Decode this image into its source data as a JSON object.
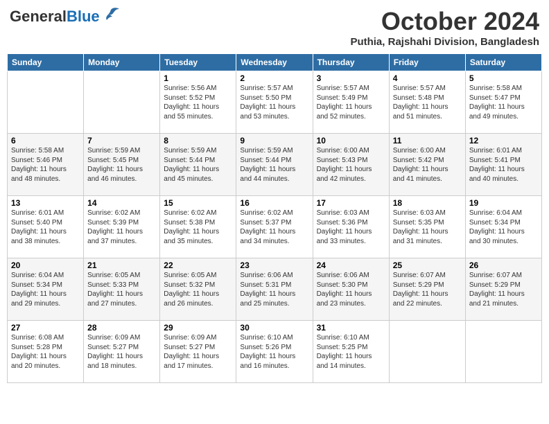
{
  "header": {
    "logo_general": "General",
    "logo_blue": "Blue",
    "month_title": "October 2024",
    "subtitle": "Puthia, Rajshahi Division, Bangladesh"
  },
  "days_of_week": [
    "Sunday",
    "Monday",
    "Tuesday",
    "Wednesday",
    "Thursday",
    "Friday",
    "Saturday"
  ],
  "weeks": [
    [
      {
        "day": "",
        "info": ""
      },
      {
        "day": "",
        "info": ""
      },
      {
        "day": "1",
        "info": "Sunrise: 5:56 AM\nSunset: 5:52 PM\nDaylight: 11 hours and 55 minutes."
      },
      {
        "day": "2",
        "info": "Sunrise: 5:57 AM\nSunset: 5:50 PM\nDaylight: 11 hours and 53 minutes."
      },
      {
        "day": "3",
        "info": "Sunrise: 5:57 AM\nSunset: 5:49 PM\nDaylight: 11 hours and 52 minutes."
      },
      {
        "day": "4",
        "info": "Sunrise: 5:57 AM\nSunset: 5:48 PM\nDaylight: 11 hours and 51 minutes."
      },
      {
        "day": "5",
        "info": "Sunrise: 5:58 AM\nSunset: 5:47 PM\nDaylight: 11 hours and 49 minutes."
      }
    ],
    [
      {
        "day": "6",
        "info": "Sunrise: 5:58 AM\nSunset: 5:46 PM\nDaylight: 11 hours and 48 minutes."
      },
      {
        "day": "7",
        "info": "Sunrise: 5:59 AM\nSunset: 5:45 PM\nDaylight: 11 hours and 46 minutes."
      },
      {
        "day": "8",
        "info": "Sunrise: 5:59 AM\nSunset: 5:44 PM\nDaylight: 11 hours and 45 minutes."
      },
      {
        "day": "9",
        "info": "Sunrise: 5:59 AM\nSunset: 5:44 PM\nDaylight: 11 hours and 44 minutes."
      },
      {
        "day": "10",
        "info": "Sunrise: 6:00 AM\nSunset: 5:43 PM\nDaylight: 11 hours and 42 minutes."
      },
      {
        "day": "11",
        "info": "Sunrise: 6:00 AM\nSunset: 5:42 PM\nDaylight: 11 hours and 41 minutes."
      },
      {
        "day": "12",
        "info": "Sunrise: 6:01 AM\nSunset: 5:41 PM\nDaylight: 11 hours and 40 minutes."
      }
    ],
    [
      {
        "day": "13",
        "info": "Sunrise: 6:01 AM\nSunset: 5:40 PM\nDaylight: 11 hours and 38 minutes."
      },
      {
        "day": "14",
        "info": "Sunrise: 6:02 AM\nSunset: 5:39 PM\nDaylight: 11 hours and 37 minutes."
      },
      {
        "day": "15",
        "info": "Sunrise: 6:02 AM\nSunset: 5:38 PM\nDaylight: 11 hours and 35 minutes."
      },
      {
        "day": "16",
        "info": "Sunrise: 6:02 AM\nSunset: 5:37 PM\nDaylight: 11 hours and 34 minutes."
      },
      {
        "day": "17",
        "info": "Sunrise: 6:03 AM\nSunset: 5:36 PM\nDaylight: 11 hours and 33 minutes."
      },
      {
        "day": "18",
        "info": "Sunrise: 6:03 AM\nSunset: 5:35 PM\nDaylight: 11 hours and 31 minutes."
      },
      {
        "day": "19",
        "info": "Sunrise: 6:04 AM\nSunset: 5:34 PM\nDaylight: 11 hours and 30 minutes."
      }
    ],
    [
      {
        "day": "20",
        "info": "Sunrise: 6:04 AM\nSunset: 5:34 PM\nDaylight: 11 hours and 29 minutes."
      },
      {
        "day": "21",
        "info": "Sunrise: 6:05 AM\nSunset: 5:33 PM\nDaylight: 11 hours and 27 minutes."
      },
      {
        "day": "22",
        "info": "Sunrise: 6:05 AM\nSunset: 5:32 PM\nDaylight: 11 hours and 26 minutes."
      },
      {
        "day": "23",
        "info": "Sunrise: 6:06 AM\nSunset: 5:31 PM\nDaylight: 11 hours and 25 minutes."
      },
      {
        "day": "24",
        "info": "Sunrise: 6:06 AM\nSunset: 5:30 PM\nDaylight: 11 hours and 23 minutes."
      },
      {
        "day": "25",
        "info": "Sunrise: 6:07 AM\nSunset: 5:29 PM\nDaylight: 11 hours and 22 minutes."
      },
      {
        "day": "26",
        "info": "Sunrise: 6:07 AM\nSunset: 5:29 PM\nDaylight: 11 hours and 21 minutes."
      }
    ],
    [
      {
        "day": "27",
        "info": "Sunrise: 6:08 AM\nSunset: 5:28 PM\nDaylight: 11 hours and 20 minutes."
      },
      {
        "day": "28",
        "info": "Sunrise: 6:09 AM\nSunset: 5:27 PM\nDaylight: 11 hours and 18 minutes."
      },
      {
        "day": "29",
        "info": "Sunrise: 6:09 AM\nSunset: 5:27 PM\nDaylight: 11 hours and 17 minutes."
      },
      {
        "day": "30",
        "info": "Sunrise: 6:10 AM\nSunset: 5:26 PM\nDaylight: 11 hours and 16 minutes."
      },
      {
        "day": "31",
        "info": "Sunrise: 6:10 AM\nSunset: 5:25 PM\nDaylight: 11 hours and 14 minutes."
      },
      {
        "day": "",
        "info": ""
      },
      {
        "day": "",
        "info": ""
      }
    ]
  ]
}
